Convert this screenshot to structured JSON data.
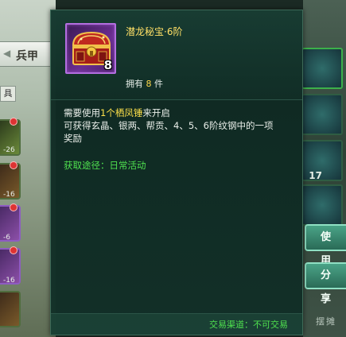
{
  "background": {
    "left_tab_label": "兵甲",
    "left_side_label": "具",
    "left_numbers": [
      "-26",
      "-16",
      "-6",
      "-16"
    ],
    "right_slot_count": "17",
    "buttons": {
      "use_label": "使用",
      "share_label": "分享"
    },
    "bottom_right_label": "摆摊"
  },
  "tooltip": {
    "item": {
      "name": "潜龙秘宝·6阶",
      "icon": "treasure-chest-icon",
      "stack_count": "8",
      "quality_color": "#b36ee0"
    },
    "owned": {
      "prefix": "拥有",
      "count": "8",
      "suffix": "件"
    },
    "description": {
      "line1_prefix": "需要使用",
      "line1_highlight": "1个栖凤锤",
      "line1_suffix": "来开启",
      "line2": "可获得玄晶、银两、帮贡、4、5、6阶纹钢中的一项",
      "line3": "奖励"
    },
    "source": {
      "label": "获取途径：",
      "value": "日常活动"
    },
    "trade": {
      "label": "交易渠道：",
      "value": "不可交易"
    },
    "colors": {
      "name": "#ffe066",
      "highlight": "#ffe14a",
      "green": "#4fe04f"
    }
  }
}
